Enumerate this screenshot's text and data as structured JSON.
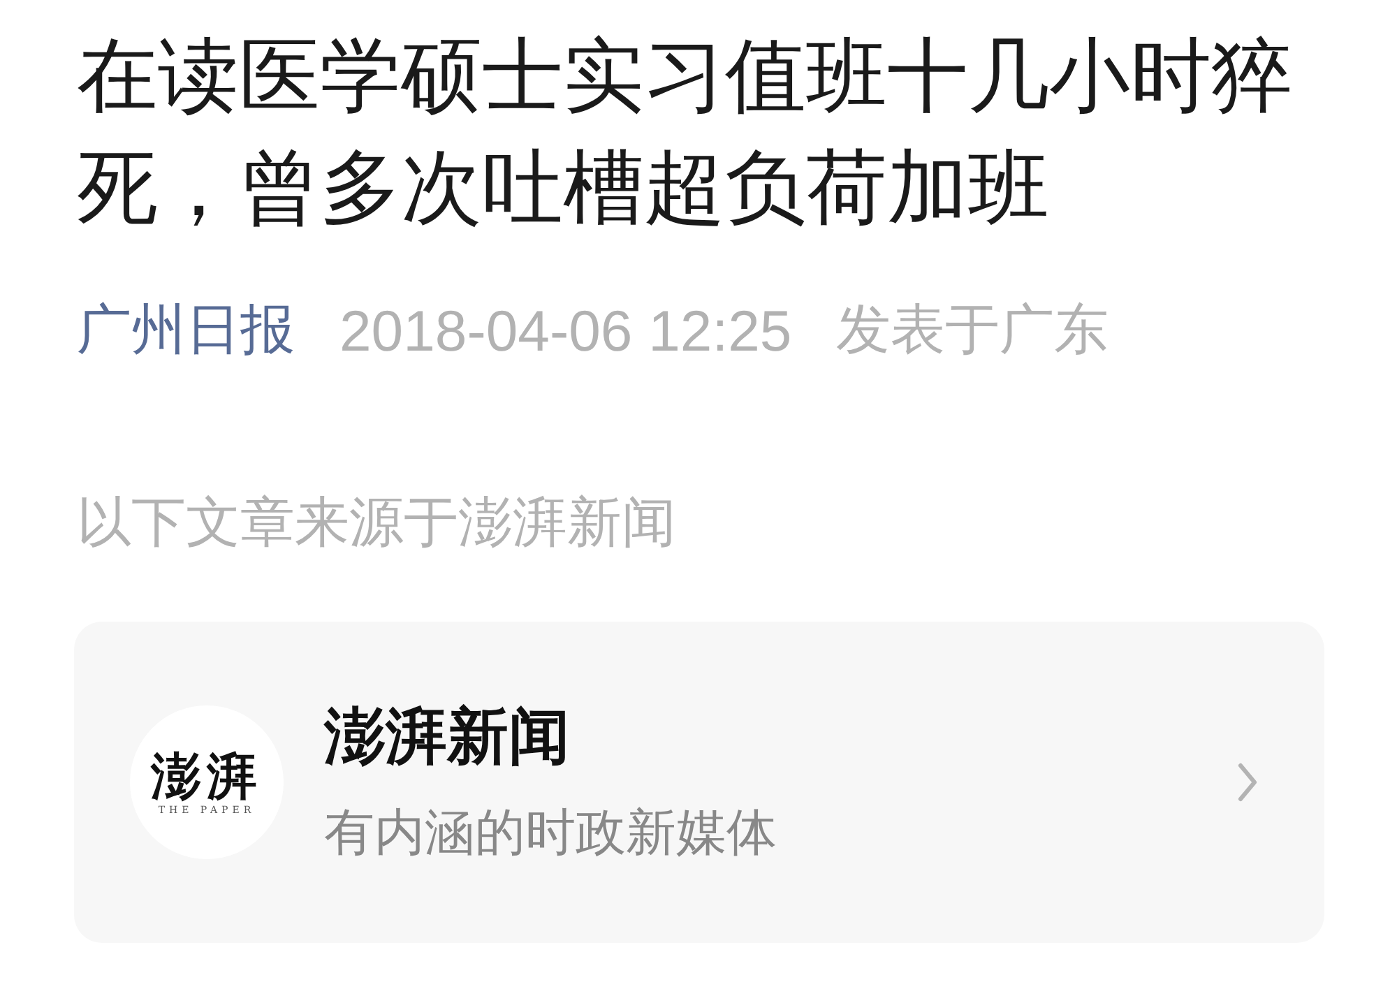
{
  "article": {
    "title": "在读医学硕士实习值班十几小时猝死，曾多次吐槽超负荷加班",
    "author": "广州日报",
    "date": "2018-04-06 12:25",
    "location": "发表于广东"
  },
  "source_note": "以下文章来源于澎湃新闻",
  "source_card": {
    "logo": {
      "mark": "澎湃",
      "tagline": "THE PAPER"
    },
    "name": "澎湃新闻",
    "description": "有内涵的时政新媒体"
  }
}
